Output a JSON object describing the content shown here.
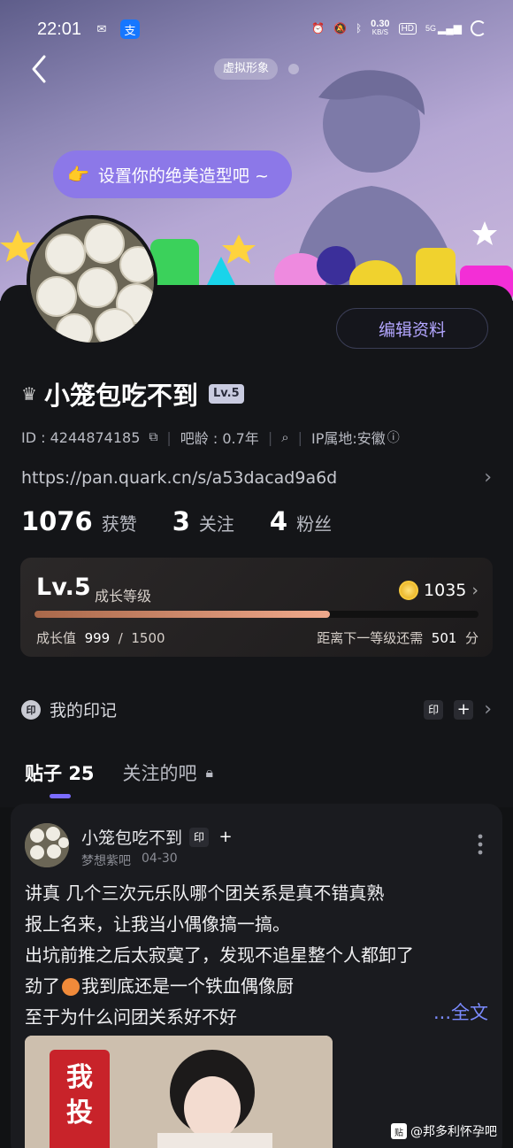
{
  "status_bar": {
    "time": "22:01",
    "net_speed": "0.30",
    "net_unit": "KB/S",
    "hd": "HD",
    "signal": "5G"
  },
  "header": {
    "avatar_tag": "虚拟形象",
    "style_button": "设置你的绝美造型吧 ~"
  },
  "profile": {
    "name": "小笼包吃不到",
    "level_badge": "Lv.5",
    "edit_button": "编辑资料",
    "id": "ID : 4244874185",
    "bar_age": "吧龄 : 0.7年",
    "ip": "IP属地:安徽",
    "link": "https://pan.quark.cn/s/a53dacad9a6d",
    "stats": [
      {
        "num": "1076",
        "label": "获赞"
      },
      {
        "num": "3",
        "label": "关注"
      },
      {
        "num": "4",
        "label": "粉丝"
      }
    ]
  },
  "level": {
    "title": "Lv.5",
    "subtitle": "成长等级",
    "coins": "1035",
    "progress_value": 999,
    "progress_max": 1500,
    "left_label": "成长值",
    "left_value": "999",
    "left_sep": "/",
    "left_max": "1500",
    "right_label": "距离下一等级还需",
    "right_value": "501",
    "right_unit": "分"
  },
  "marks": {
    "badge": "印",
    "label": "我的印记",
    "chip": "印",
    "plus": "+"
  },
  "tabs": [
    {
      "label": "贴子",
      "count": "25"
    },
    {
      "label": "关注的吧"
    }
  ],
  "post": {
    "author": "小笼包吃不到",
    "chip": "印",
    "plus": "+",
    "forum": "梦想紫吧",
    "date": "04-30",
    "lines": [
      "讲真 几个三次元乐队哪个团关系是真不错真熟",
      "报上名来，让我当小偶像搞一搞。",
      "出坑前推之后太寂寞了，发现不追星整个人都卸了",
      "劲了",
      "我到底还是一个铁血偶像厨",
      "至于为什么问团关系好不好"
    ],
    "fulltext": "...全文",
    "image_sign": "我投"
  },
  "watermark": {
    "badge": "贴",
    "text": "@邦多利怀孕吧"
  },
  "colors": {
    "accent": "#7b6cff",
    "edit_text": "#b3a6ff",
    "style_button": "#8c78e8",
    "bar_fill": "#f0a98c"
  }
}
